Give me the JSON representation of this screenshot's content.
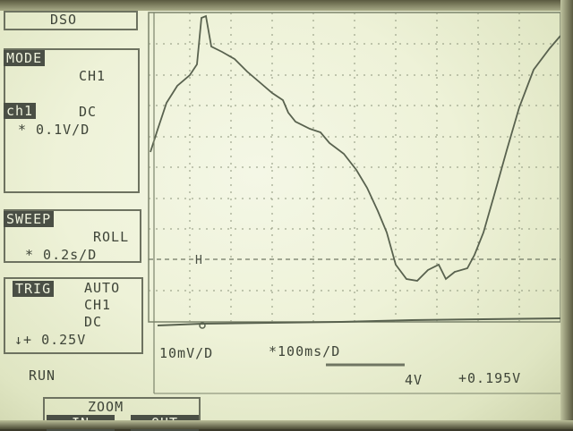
{
  "panel": {
    "title": "DSO",
    "mode_label": "MODE",
    "mode_value": "CH1",
    "ch_label": "ch1",
    "ch_coupling": "DC",
    "ch_scale": "* 0.1V/D",
    "sweep_label": "SWEEP",
    "sweep_mode": "ROLL",
    "sweep_scale": "* 0.2s/D",
    "trig_label": "TRIG",
    "trig_mode": "AUTO",
    "trig_source": "CH1",
    "trig_coupling": "DC",
    "trig_level": "↓+ 0.25V",
    "run_status": "RUN",
    "zoom_label": "ZOOM",
    "zoom_in": "IN",
    "zoom_out": "OUT"
  },
  "display": {
    "zoom_scale": "10mV/D",
    "zoom_time": "*100ms/D",
    "readout_range": "4V",
    "readout_value": "+0.195V"
  },
  "colors": {
    "trace": "#59624f",
    "grid": "#8d957c",
    "text": "#3e4438",
    "inverse_bg": "#4a4f45"
  }
}
